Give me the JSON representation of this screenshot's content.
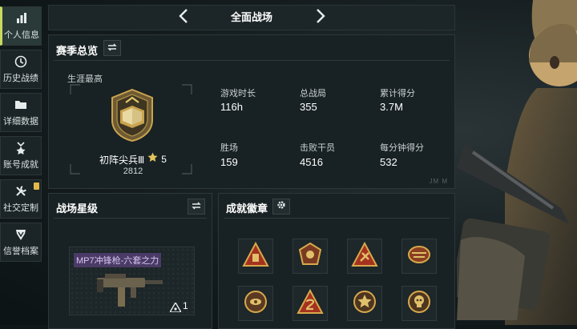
{
  "sidebar": {
    "items": [
      {
        "label": "个人信息",
        "icon": "bar-chart-icon"
      },
      {
        "label": "历史战绩",
        "icon": "clock-icon"
      },
      {
        "label": "详细数据",
        "icon": "folder-icon"
      },
      {
        "label": "账号成就",
        "icon": "medal-icon"
      },
      {
        "label": "社交定制",
        "icon": "wrench-icon"
      },
      {
        "label": "信誉档案",
        "icon": "shield-icon"
      }
    ]
  },
  "header": {
    "title": "全面战场"
  },
  "season": {
    "title": "赛季总览",
    "career_label": "生涯最高",
    "rank_name": "初阵尖兵Ⅲ",
    "stars": "5",
    "rank_score": "2812",
    "watermark": "JM M",
    "stats": [
      {
        "label": "游戏时长",
        "value": "116h"
      },
      {
        "label": "总战局",
        "value": "355"
      },
      {
        "label": "累计得分",
        "value": "3.7M"
      },
      {
        "label": "胜场",
        "value": "159"
      },
      {
        "label": "击败干员",
        "value": "4516"
      },
      {
        "label": "每分钟得分",
        "value": "532"
      }
    ]
  },
  "battle_star": {
    "title": "战场星级",
    "weapon_name": "MP7冲锋枪-六套之力",
    "weapon_stars": "1"
  },
  "achievements": {
    "title": "成就徽章"
  },
  "colors": {
    "accent": "#c7d95e",
    "gold": "#c9a44e",
    "badge_red": "#b23a24"
  }
}
